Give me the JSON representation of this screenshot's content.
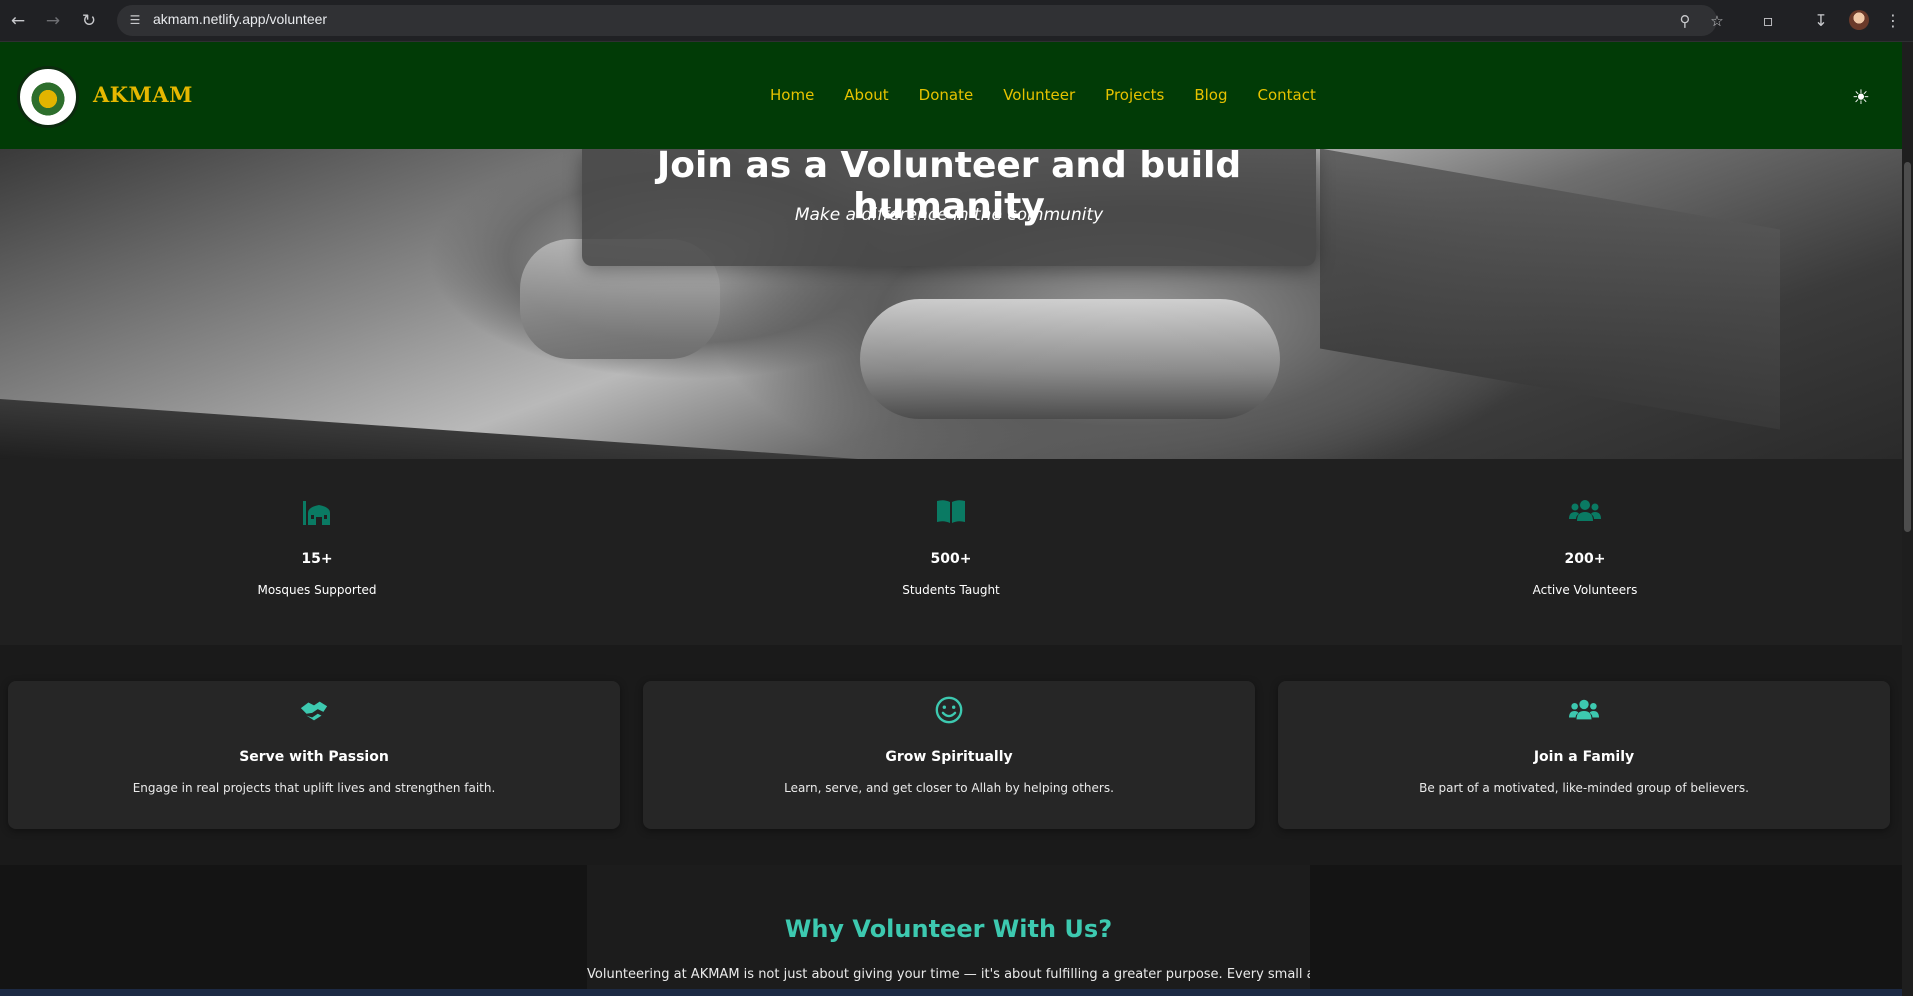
{
  "browser": {
    "url": "akmam.netlify.app/volunteer"
  },
  "header": {
    "brand": "AKMAM",
    "nav": [
      "Home",
      "About",
      "Donate",
      "Volunteer",
      "Projects",
      "Blog",
      "Contact"
    ]
  },
  "hero": {
    "title": "Join as a Volunteer and build humanity",
    "subtitle": "Make a difference in the community"
  },
  "stats": [
    {
      "icon": "mosque-icon",
      "value": "15+",
      "label": "Mosques Supported"
    },
    {
      "icon": "book-icon",
      "value": "500+",
      "label": "Students Taught"
    },
    {
      "icon": "users-icon",
      "value": "200+",
      "label": "Active Volunteers"
    }
  ],
  "features": [
    {
      "icon": "handshake-icon",
      "title": "Serve with Passion",
      "desc": "Engage in real projects that uplift lives and strengthen faith."
    },
    {
      "icon": "smile-icon",
      "title": "Grow Spiritually",
      "desc": "Learn, serve, and get closer to Allah by helping others."
    },
    {
      "icon": "users-icon",
      "title": "Join a Family",
      "desc": "Be part of a motivated, like-minded group of believers."
    }
  ],
  "why": {
    "title": "Why Volunteer With Us?",
    "text": "Volunteering at AKMAM is not just about giving your time — it's about fulfilling a greater purpose. Every small act"
  },
  "colors": {
    "header_bg": "#013b06",
    "nav_text": "#e6c200",
    "stat_icon": "#0a7a63",
    "accent": "#3dc9b0"
  }
}
